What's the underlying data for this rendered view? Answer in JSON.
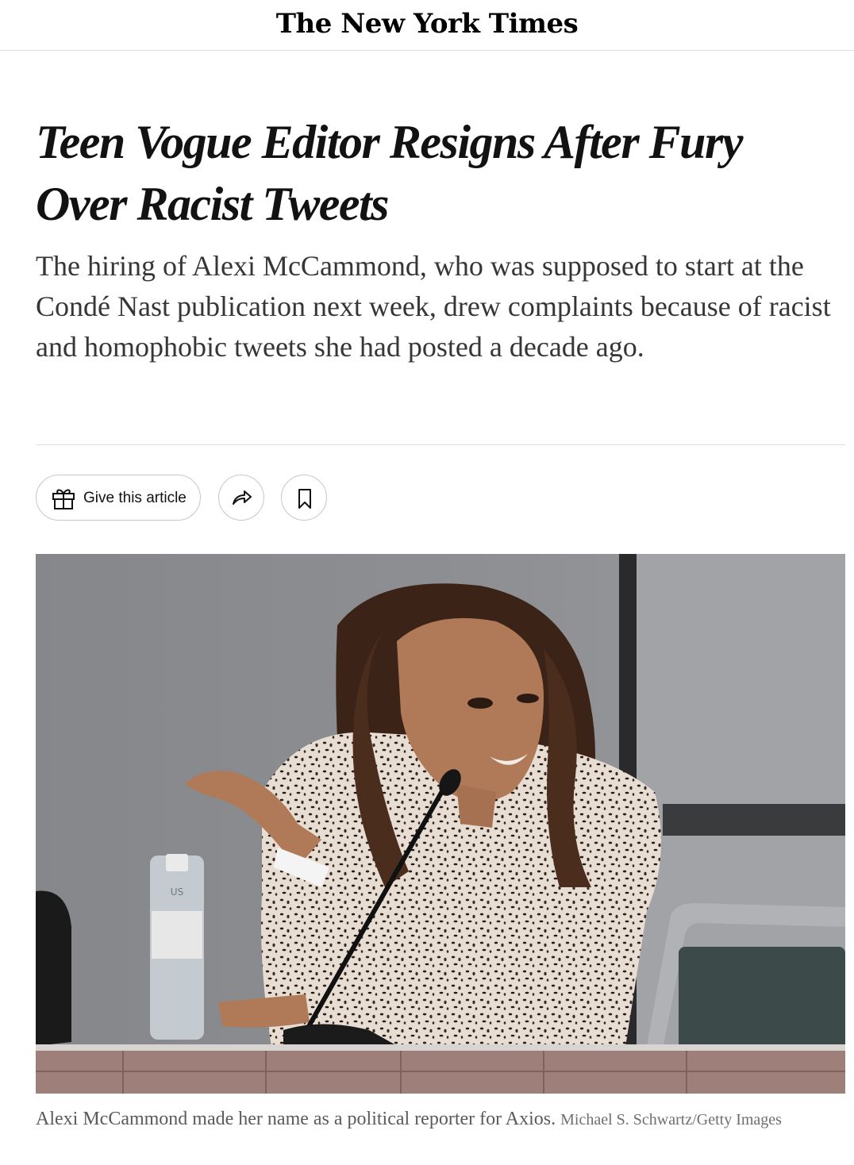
{
  "masthead": {
    "logo_text": "The New York Times"
  },
  "article": {
    "headline_line1": "Teen Vogue Editor Resigns After Fury",
    "headline_line2": "Over Racist Tweets",
    "summary": "The hiring of Alexi McCammond, who was supposed to start at the Condé Nast publication next week, drew complaints because of racist and homophobic tweets she had posted a decade ago."
  },
  "share_bar": {
    "gift_button_label": "Give this article",
    "gift_icon": "gift-icon",
    "share_icon": "share-arrow-icon",
    "save_icon": "bookmark-icon"
  },
  "image": {
    "bottle_label_text": "US"
  },
  "caption": {
    "text": "Alexi McCammond made her name as a political reporter for Axios.",
    "credit": "Michael S. Schwartz/Getty Images"
  }
}
